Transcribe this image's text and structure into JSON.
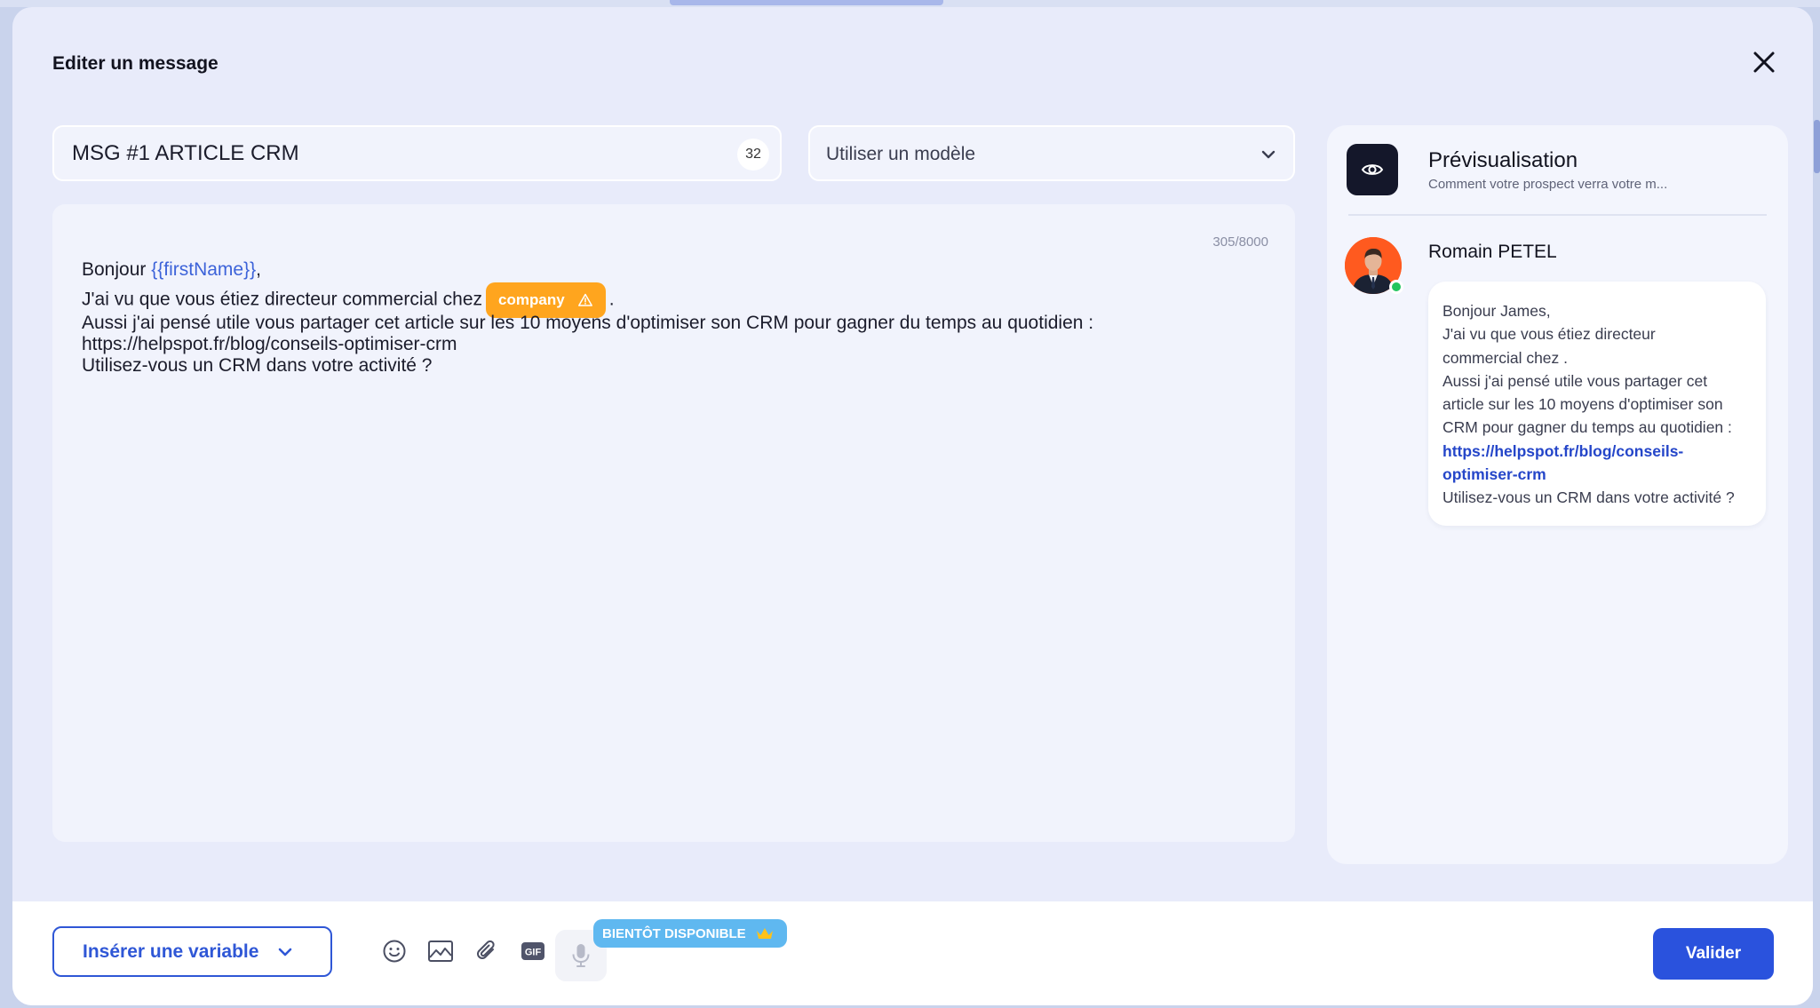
{
  "modal": {
    "title": "Editer un message"
  },
  "message_name": {
    "value": "MSG #1 ARTICLE CRM",
    "char_count": "32"
  },
  "template_select": {
    "placeholder": "Utiliser un modèle"
  },
  "editor": {
    "char_counter": "305/8000",
    "greeting": "Bonjour ",
    "greeting_variable": "{{firstName}}",
    "greeting_end": ",",
    "line2_start": "J'ai vu que vous étiez directeur commercial chez",
    "company_variable": "company",
    "line2_end": ".",
    "line3": "Aussi j'ai pensé utile vous partager cet article sur les 10 moyens d'optimiser son CRM pour gagner du temps au quotidien :",
    "line4": "https://helpspot.fr/blog/conseils-optimiser-crm",
    "line5": "Utilisez-vous un CRM dans votre activité ?"
  },
  "preview": {
    "title": "Prévisualisation",
    "subtitle": "Comment votre prospect verra votre m...",
    "sender_name": "Romain PETEL",
    "bubble": {
      "l1": "Bonjour James,",
      "l2": "J'ai vu que vous étiez directeur",
      "l3": "commercial chez .",
      "l4": "Aussi j'ai pensé utile vous partager cet",
      "l5": "article sur les 10 moyens d'optimiser son",
      "l6": "CRM pour gagner du temps au quotidien :",
      "link1": "https://helpspot.fr/blog/conseils-",
      "link2": "optimiser-crm",
      "l7": "Utilisez-vous un CRM dans votre activité ?"
    }
  },
  "footer": {
    "insert_variable_label": "Insérer une variable",
    "coming_soon_badge": "BIENTÔT DISPONIBLE",
    "validate_label": "Valider",
    "gif_label": "GIF",
    "icons": [
      "emoji-icon",
      "image-icon",
      "attachment-icon",
      "gif-icon",
      "microphone-icon",
      "crown-icon"
    ]
  },
  "colors": {
    "accent": "#2a52dd",
    "variable_blue": "#3d63d9",
    "company_chip": "#ffa51e",
    "coming_soon": "#5fb8f0",
    "online": "#22c55e"
  }
}
